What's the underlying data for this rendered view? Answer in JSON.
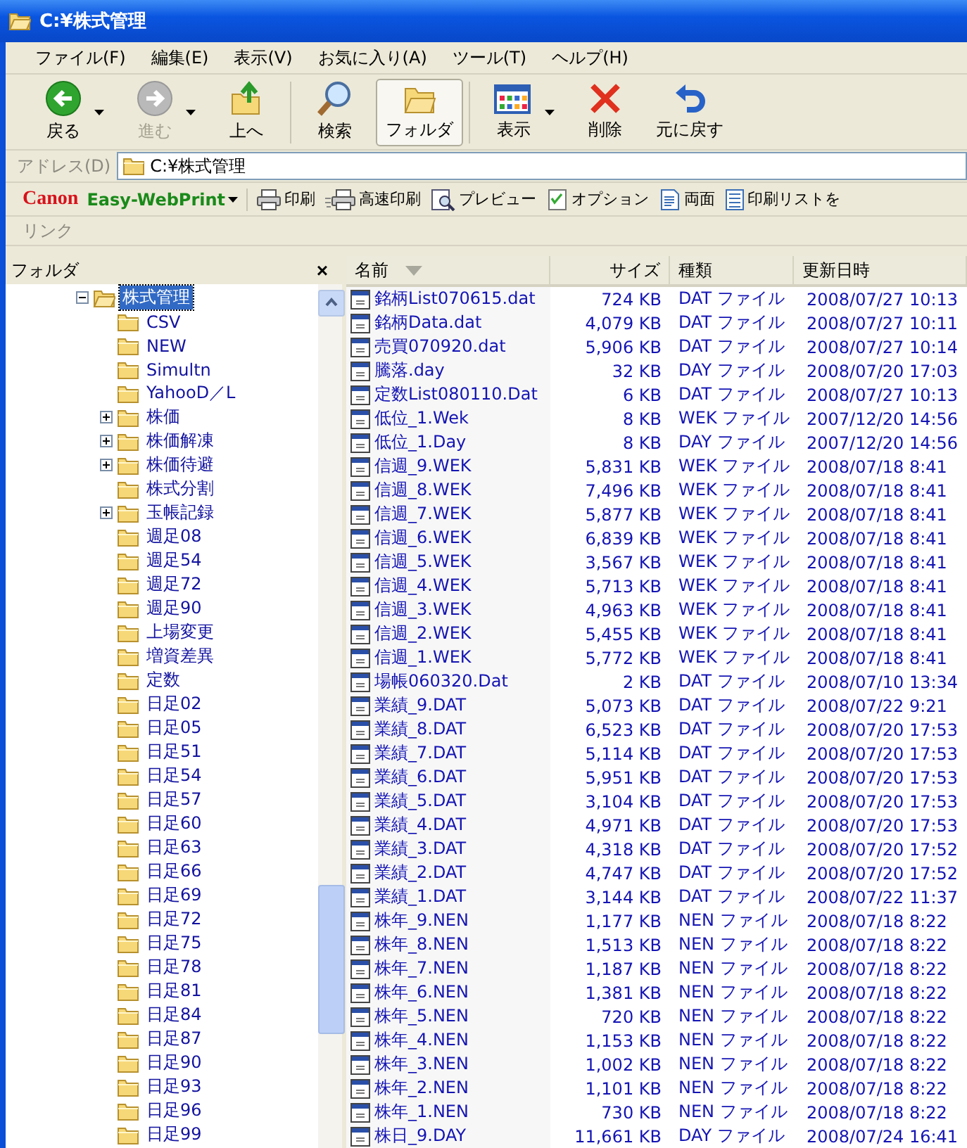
{
  "window": {
    "title": "C:¥株式管理"
  },
  "menu": [
    "ファイル(F)",
    "編集(E)",
    "表示(V)",
    "お気に入り(A)",
    "ツール(T)",
    "ヘルプ(H)"
  ],
  "toolbar_groups": [
    {
      "buttons": [
        {
          "kind": "back",
          "label": "戻る",
          "disabled": false,
          "selected": false,
          "has_menu": true
        },
        {
          "kind": "forward",
          "label": "進む",
          "disabled": true,
          "selected": false,
          "has_menu": true
        },
        {
          "kind": "up",
          "label": "上へ",
          "disabled": false,
          "selected": false,
          "has_menu": false
        }
      ]
    },
    {
      "buttons": [
        {
          "kind": "search",
          "label": "検索",
          "disabled": false,
          "selected": false,
          "has_menu": false
        },
        {
          "kind": "folders",
          "label": "フォルダ",
          "disabled": false,
          "selected": true,
          "has_menu": false
        }
      ]
    },
    {
      "buttons": [
        {
          "kind": "views",
          "label": "表示",
          "disabled": false,
          "selected": false,
          "has_menu": true
        },
        {
          "kind": "delete",
          "label": "削除",
          "disabled": false,
          "selected": false,
          "has_menu": false
        },
        {
          "kind": "undo",
          "label": "元に戻す",
          "disabled": false,
          "selected": false,
          "has_menu": false
        }
      ]
    }
  ],
  "address": {
    "label": "アドレス(D)",
    "value": "C:¥株式管理"
  },
  "print_bar": {
    "brand": "Canon",
    "product": "Easy-WebPrint",
    "buttons": [
      {
        "kind": "print",
        "label": "印刷"
      },
      {
        "kind": "fast",
        "label": "高速印刷"
      },
      {
        "kind": "preview",
        "label": "プレビュー"
      },
      {
        "kind": "option",
        "label": "オプション"
      },
      {
        "kind": "duplex",
        "label": "両面"
      },
      {
        "kind": "list",
        "label": "印刷リストを"
      }
    ]
  },
  "links_bar": {
    "label": "リンク"
  },
  "folder_pane": {
    "title": "フォルダ",
    "close": "×",
    "tree": [
      {
        "label": "株式管理",
        "selected": true,
        "expanded": true,
        "has_subfolders": true,
        "children": [
          {
            "label": "CSV",
            "selected": false,
            "expanded": false,
            "has_subfolders": false
          },
          {
            "label": "NEW",
            "selected": false,
            "expanded": false,
            "has_subfolders": false
          },
          {
            "label": "Simultn",
            "selected": false,
            "expanded": false,
            "has_subfolders": false
          },
          {
            "label": "YahooD／L",
            "selected": false,
            "expanded": false,
            "has_subfolders": false
          },
          {
            "label": "株価",
            "selected": false,
            "expanded": false,
            "has_subfolders": true
          },
          {
            "label": "株価解凍",
            "selected": false,
            "expanded": false,
            "has_subfolders": true
          },
          {
            "label": "株価待避",
            "selected": false,
            "expanded": false,
            "has_subfolders": true
          },
          {
            "label": "株式分割",
            "selected": false,
            "expanded": false,
            "has_subfolders": false
          },
          {
            "label": "玉帳記録",
            "selected": false,
            "expanded": false,
            "has_subfolders": true
          },
          {
            "label": "週足08",
            "selected": false,
            "expanded": false,
            "has_subfolders": false
          },
          {
            "label": "週足54",
            "selected": false,
            "expanded": false,
            "has_subfolders": false
          },
          {
            "label": "週足72",
            "selected": false,
            "expanded": false,
            "has_subfolders": false
          },
          {
            "label": "週足90",
            "selected": false,
            "expanded": false,
            "has_subfolders": false
          },
          {
            "label": "上場変更",
            "selected": false,
            "expanded": false,
            "has_subfolders": false
          },
          {
            "label": "増資差異",
            "selected": false,
            "expanded": false,
            "has_subfolders": false
          },
          {
            "label": "定数",
            "selected": false,
            "expanded": false,
            "has_subfolders": false
          },
          {
            "label": "日足02",
            "selected": false,
            "expanded": false,
            "has_subfolders": false
          },
          {
            "label": "日足05",
            "selected": false,
            "expanded": false,
            "has_subfolders": false
          },
          {
            "label": "日足51",
            "selected": false,
            "expanded": false,
            "has_subfolders": false
          },
          {
            "label": "日足54",
            "selected": false,
            "expanded": false,
            "has_subfolders": false
          },
          {
            "label": "日足57",
            "selected": false,
            "expanded": false,
            "has_subfolders": false
          },
          {
            "label": "日足60",
            "selected": false,
            "expanded": false,
            "has_subfolders": false
          },
          {
            "label": "日足63",
            "selected": false,
            "expanded": false,
            "has_subfolders": false
          },
          {
            "label": "日足66",
            "selected": false,
            "expanded": false,
            "has_subfolders": false
          },
          {
            "label": "日足69",
            "selected": false,
            "expanded": false,
            "has_subfolders": false
          },
          {
            "label": "日足72",
            "selected": false,
            "expanded": false,
            "has_subfolders": false
          },
          {
            "label": "日足75",
            "selected": false,
            "expanded": false,
            "has_subfolders": false
          },
          {
            "label": "日足78",
            "selected": false,
            "expanded": false,
            "has_subfolders": false
          },
          {
            "label": "日足81",
            "selected": false,
            "expanded": false,
            "has_subfolders": false
          },
          {
            "label": "日足84",
            "selected": false,
            "expanded": false,
            "has_subfolders": false
          },
          {
            "label": "日足87",
            "selected": false,
            "expanded": false,
            "has_subfolders": false
          },
          {
            "label": "日足90",
            "selected": false,
            "expanded": false,
            "has_subfolders": false
          },
          {
            "label": "日足93",
            "selected": false,
            "expanded": false,
            "has_subfolders": false
          },
          {
            "label": "日足96",
            "selected": false,
            "expanded": false,
            "has_subfolders": false
          },
          {
            "label": "日足99",
            "selected": false,
            "expanded": false,
            "has_subfolders": false
          }
        ]
      }
    ]
  },
  "file_list": {
    "columns": [
      {
        "label": "名前",
        "sorted": true
      },
      {
        "label": "サイズ",
        "sorted": false
      },
      {
        "label": "種類",
        "sorted": false
      },
      {
        "label": "更新日時",
        "sorted": false
      }
    ],
    "rows": [
      {
        "name": "銘柄List070615.dat",
        "size": "724 KB",
        "type": "DAT ファイル",
        "modified": "2008/07/27 10:13"
      },
      {
        "name": "銘柄Data.dat",
        "size": "4,079 KB",
        "type": "DAT ファイル",
        "modified": "2008/07/27 10:11"
      },
      {
        "name": "売買070920.dat",
        "size": "5,906 KB",
        "type": "DAT ファイル",
        "modified": "2008/07/27 10:14"
      },
      {
        "name": "騰落.day",
        "size": "32 KB",
        "type": "DAY ファイル",
        "modified": "2008/07/20 17:03"
      },
      {
        "name": "定数List080110.Dat",
        "size": "6 KB",
        "type": "DAT ファイル",
        "modified": "2008/07/27 10:13"
      },
      {
        "name": "低位_1.Wek",
        "size": "8 KB",
        "type": "WEK ファイル",
        "modified": "2007/12/20 14:56"
      },
      {
        "name": "低位_1.Day",
        "size": "8 KB",
        "type": "DAY ファイル",
        "modified": "2007/12/20 14:56"
      },
      {
        "name": "信週_9.WEK",
        "size": "5,831 KB",
        "type": "WEK ファイル",
        "modified": "2008/07/18 8:41"
      },
      {
        "name": "信週_8.WEK",
        "size": "7,496 KB",
        "type": "WEK ファイル",
        "modified": "2008/07/18 8:41"
      },
      {
        "name": "信週_7.WEK",
        "size": "5,877 KB",
        "type": "WEK ファイル",
        "modified": "2008/07/18 8:41"
      },
      {
        "name": "信週_6.WEK",
        "size": "6,839 KB",
        "type": "WEK ファイル",
        "modified": "2008/07/18 8:41"
      },
      {
        "name": "信週_5.WEK",
        "size": "3,567 KB",
        "type": "WEK ファイル",
        "modified": "2008/07/18 8:41"
      },
      {
        "name": "信週_4.WEK",
        "size": "5,713 KB",
        "type": "WEK ファイル",
        "modified": "2008/07/18 8:41"
      },
      {
        "name": "信週_3.WEK",
        "size": "4,963 KB",
        "type": "WEK ファイル",
        "modified": "2008/07/18 8:41"
      },
      {
        "name": "信週_2.WEK",
        "size": "5,455 KB",
        "type": "WEK ファイル",
        "modified": "2008/07/18 8:41"
      },
      {
        "name": "信週_1.WEK",
        "size": "5,772 KB",
        "type": "WEK ファイル",
        "modified": "2008/07/18 8:41"
      },
      {
        "name": "場帳060320.Dat",
        "size": "2 KB",
        "type": "DAT ファイル",
        "modified": "2008/07/10 13:34"
      },
      {
        "name": "業績_9.DAT",
        "size": "5,073 KB",
        "type": "DAT ファイル",
        "modified": "2008/07/22 9:21"
      },
      {
        "name": "業績_8.DAT",
        "size": "6,523 KB",
        "type": "DAT ファイル",
        "modified": "2008/07/20 17:53"
      },
      {
        "name": "業績_7.DAT",
        "size": "5,114 KB",
        "type": "DAT ファイル",
        "modified": "2008/07/20 17:53"
      },
      {
        "name": "業績_6.DAT",
        "size": "5,951 KB",
        "type": "DAT ファイル",
        "modified": "2008/07/20 17:53"
      },
      {
        "name": "業績_5.DAT",
        "size": "3,104 KB",
        "type": "DAT ファイル",
        "modified": "2008/07/20 17:53"
      },
      {
        "name": "業績_4.DAT",
        "size": "4,971 KB",
        "type": "DAT ファイル",
        "modified": "2008/07/20 17:53"
      },
      {
        "name": "業績_3.DAT",
        "size": "4,318 KB",
        "type": "DAT ファイル",
        "modified": "2008/07/20 17:52"
      },
      {
        "name": "業績_2.DAT",
        "size": "4,747 KB",
        "type": "DAT ファイル",
        "modified": "2008/07/20 17:52"
      },
      {
        "name": "業績_1.DAT",
        "size": "3,144 KB",
        "type": "DAT ファイル",
        "modified": "2008/07/22 11:37"
      },
      {
        "name": "株年_9.NEN",
        "size": "1,177 KB",
        "type": "NEN ファイル",
        "modified": "2008/07/18 8:22"
      },
      {
        "name": "株年_8.NEN",
        "size": "1,513 KB",
        "type": "NEN ファイル",
        "modified": "2008/07/18 8:22"
      },
      {
        "name": "株年_7.NEN",
        "size": "1,187 KB",
        "type": "NEN ファイル",
        "modified": "2008/07/18 8:22"
      },
      {
        "name": "株年_6.NEN",
        "size": "1,381 KB",
        "type": "NEN ファイル",
        "modified": "2008/07/18 8:22"
      },
      {
        "name": "株年_5.NEN",
        "size": "720 KB",
        "type": "NEN ファイル",
        "modified": "2008/07/18 8:22"
      },
      {
        "name": "株年_4.NEN",
        "size": "1,153 KB",
        "type": "NEN ファイル",
        "modified": "2008/07/18 8:22"
      },
      {
        "name": "株年_3.NEN",
        "size": "1,002 KB",
        "type": "NEN ファイル",
        "modified": "2008/07/18 8:22"
      },
      {
        "name": "株年_2.NEN",
        "size": "1,101 KB",
        "type": "NEN ファイル",
        "modified": "2008/07/18 8:22"
      },
      {
        "name": "株年_1.NEN",
        "size": "730 KB",
        "type": "NEN ファイル",
        "modified": "2008/07/18 8:22"
      },
      {
        "name": "株日_9.DAY",
        "size": "11,661 KB",
        "type": "DAY ファイル",
        "modified": "2008/07/24 16:41"
      }
    ]
  }
}
